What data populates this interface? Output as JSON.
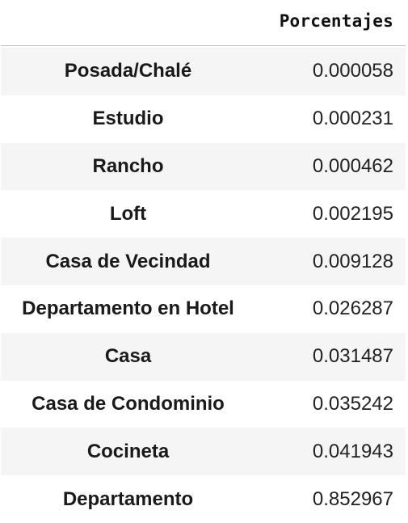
{
  "table": {
    "column_header": "Porcentajes",
    "rows": [
      {
        "label": "Posada/Chalé",
        "value": "0.000058"
      },
      {
        "label": "Estudio",
        "value": "0.000231"
      },
      {
        "label": "Rancho",
        "value": "0.000462"
      },
      {
        "label": "Loft",
        "value": "0.002195"
      },
      {
        "label": "Casa de Vecindad",
        "value": "0.009128"
      },
      {
        "label": "Departamento en Hotel",
        "value": "0.026287"
      },
      {
        "label": "Casa",
        "value": "0.031487"
      },
      {
        "label": "Casa de Condominio",
        "value": "0.035242"
      },
      {
        "label": "Cocineta",
        "value": "0.041943"
      },
      {
        "label": "Departamento",
        "value": "0.852967"
      }
    ]
  }
}
